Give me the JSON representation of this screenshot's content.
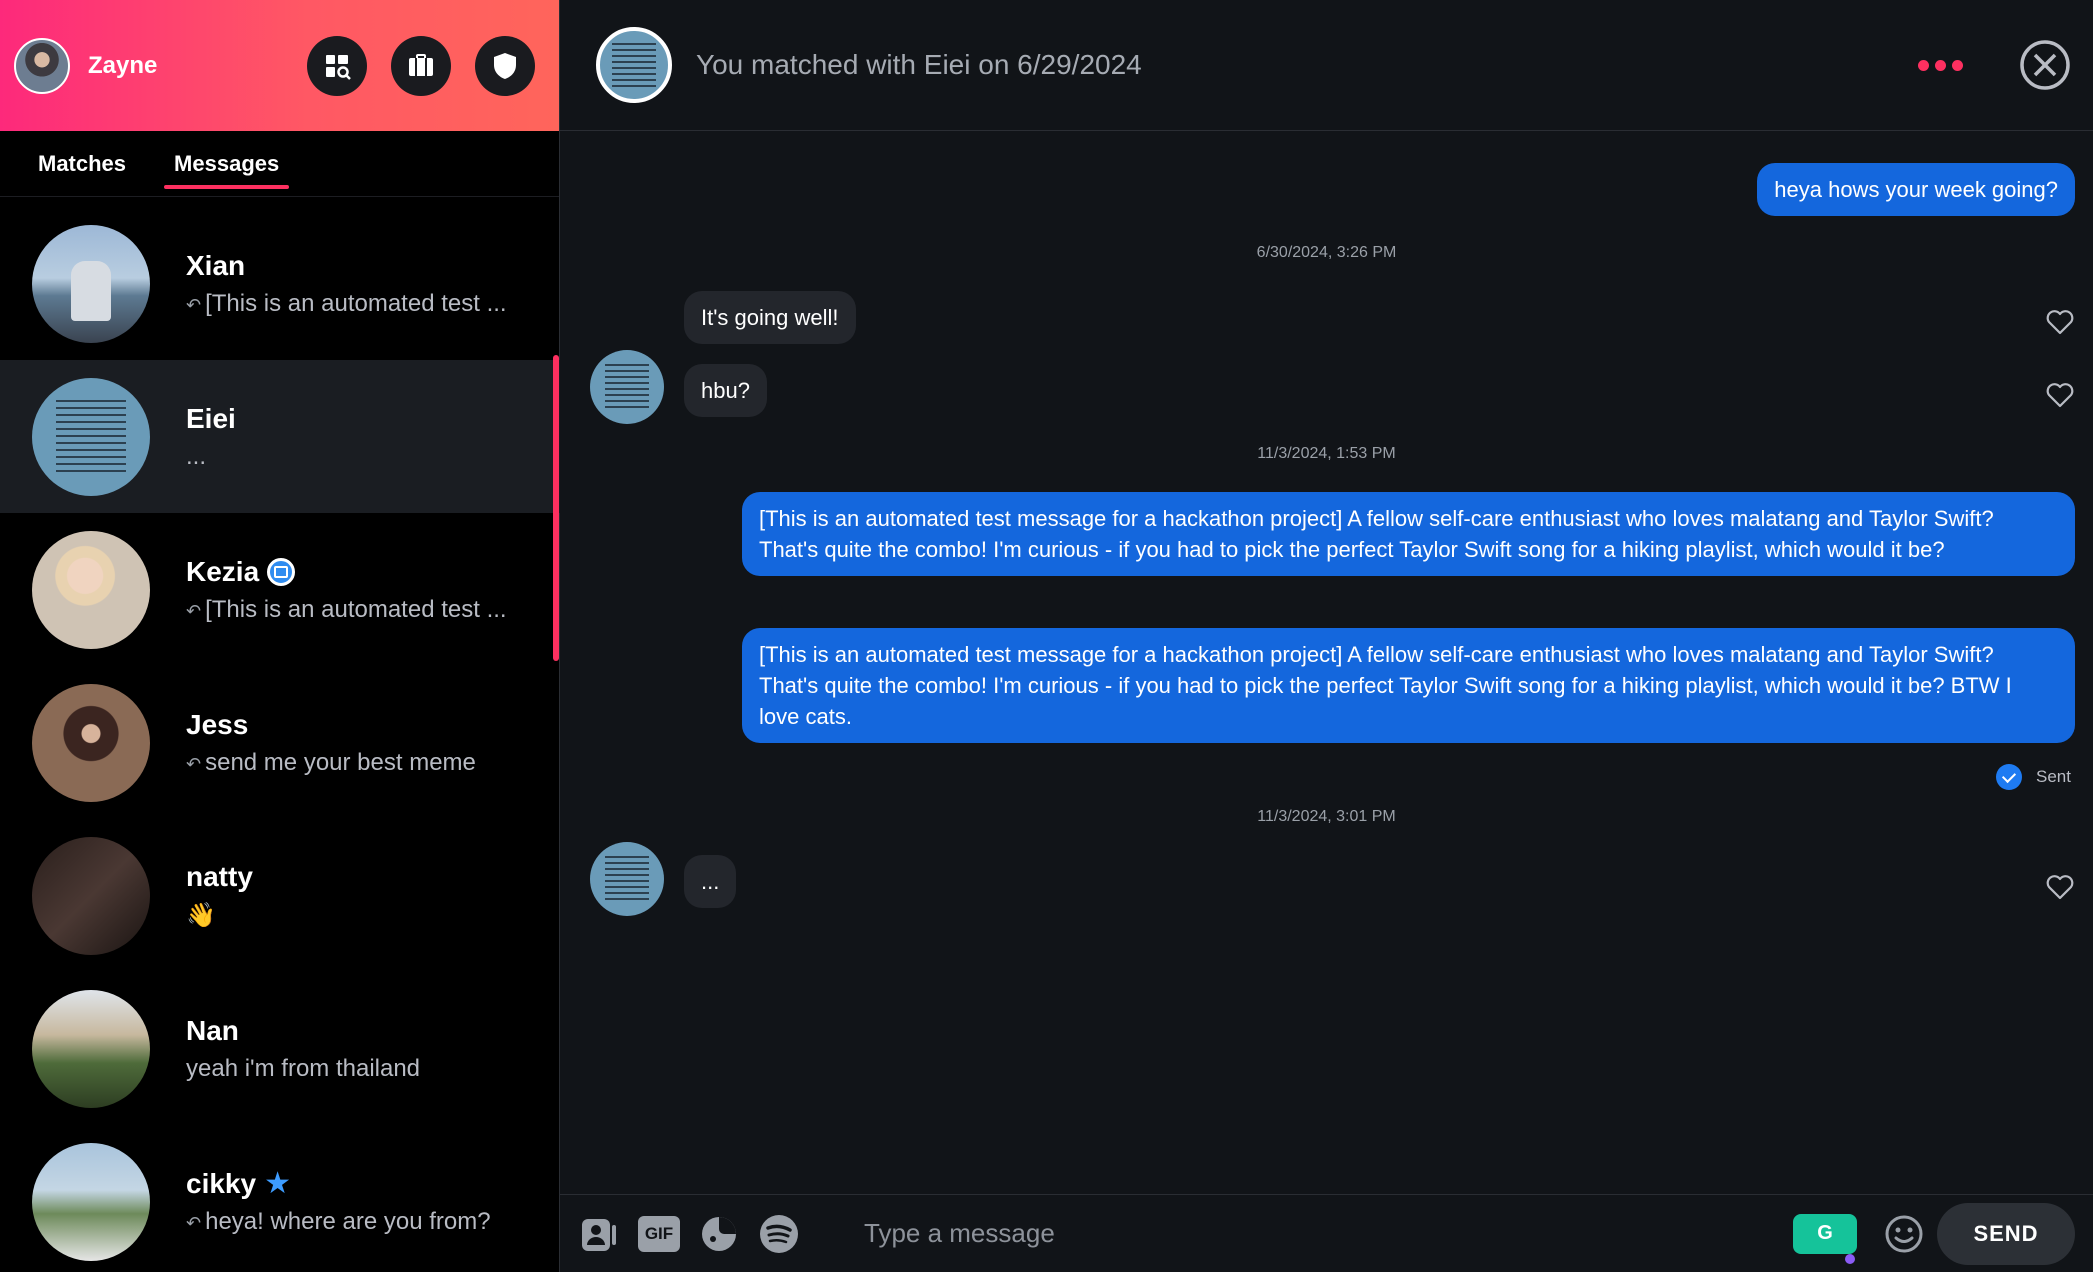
{
  "user": {
    "name": "Zayne"
  },
  "tabs": {
    "matches": "Matches",
    "messages": "Messages"
  },
  "conversations": [
    {
      "name": "Xian",
      "preview": "[This is an automated test ...",
      "replied": true,
      "badge": ""
    },
    {
      "name": "Eiei",
      "preview": "...",
      "replied": false,
      "badge": ""
    },
    {
      "name": "Kezia",
      "preview": "[This is an automated test ...",
      "replied": true,
      "badge": "verified"
    },
    {
      "name": "Jess",
      "preview": "send me your best meme",
      "replied": true,
      "badge": ""
    },
    {
      "name": "natty",
      "preview": "👋",
      "replied": false,
      "badge": ""
    },
    {
      "name": "Nan",
      "preview": "yeah i'm from thailand",
      "replied": false,
      "badge": ""
    },
    {
      "name": "cikky",
      "preview": "heya! where are you from?",
      "replied": true,
      "badge": "star"
    }
  ],
  "chat": {
    "title": "You matched with Eiei on 6/29/2024",
    "messages": [
      {
        "from": "me",
        "text": "heya hows your week going?"
      },
      {
        "stamp": "6/30/2024, 3:26 PM"
      },
      {
        "from": "them",
        "text": "It's going well!"
      },
      {
        "from": "them",
        "text": "hbu?"
      },
      {
        "stamp": "11/3/2024, 1:53 PM"
      },
      {
        "from": "me",
        "text": "[This is an automated test message for a hackathon project] A fellow self-care enthusiast who loves malatang and Taylor Swift? That's quite the combo! I'm curious - if you had to pick the perfect Taylor Swift song for a hiking playlist, which would it be?"
      },
      {
        "from": "me",
        "text": "[This is an automated test message for a hackathon project] A fellow self-care enthusiast who loves malatang and Taylor Swift? That's quite the combo! I'm curious - if you had to pick the perfect Taylor Swift song for a hiking playlist, which would it be? BTW I love cats."
      },
      {
        "stamp": "11/3/2024, 3:01 PM"
      },
      {
        "from": "them",
        "text": "..."
      }
    ],
    "sent_label": "Sent"
  },
  "composer": {
    "placeholder": "Type a message",
    "send_label": "SEND",
    "gif_label": "GIF",
    "grammarly_label": "G"
  },
  "colors": {
    "accent": "#fd3060",
    "my_bubble": "#1467dd",
    "their_bubble": "#23262c",
    "background": "#111418"
  },
  "icons": [
    "explore-icon",
    "briefcase-icon",
    "shield-icon",
    "more-options-icon",
    "close-icon",
    "heart-icon",
    "contact-card-icon",
    "gif-icon",
    "sticker-icon",
    "spotify-icon",
    "grammarly-icon",
    "emoji-icon"
  ]
}
